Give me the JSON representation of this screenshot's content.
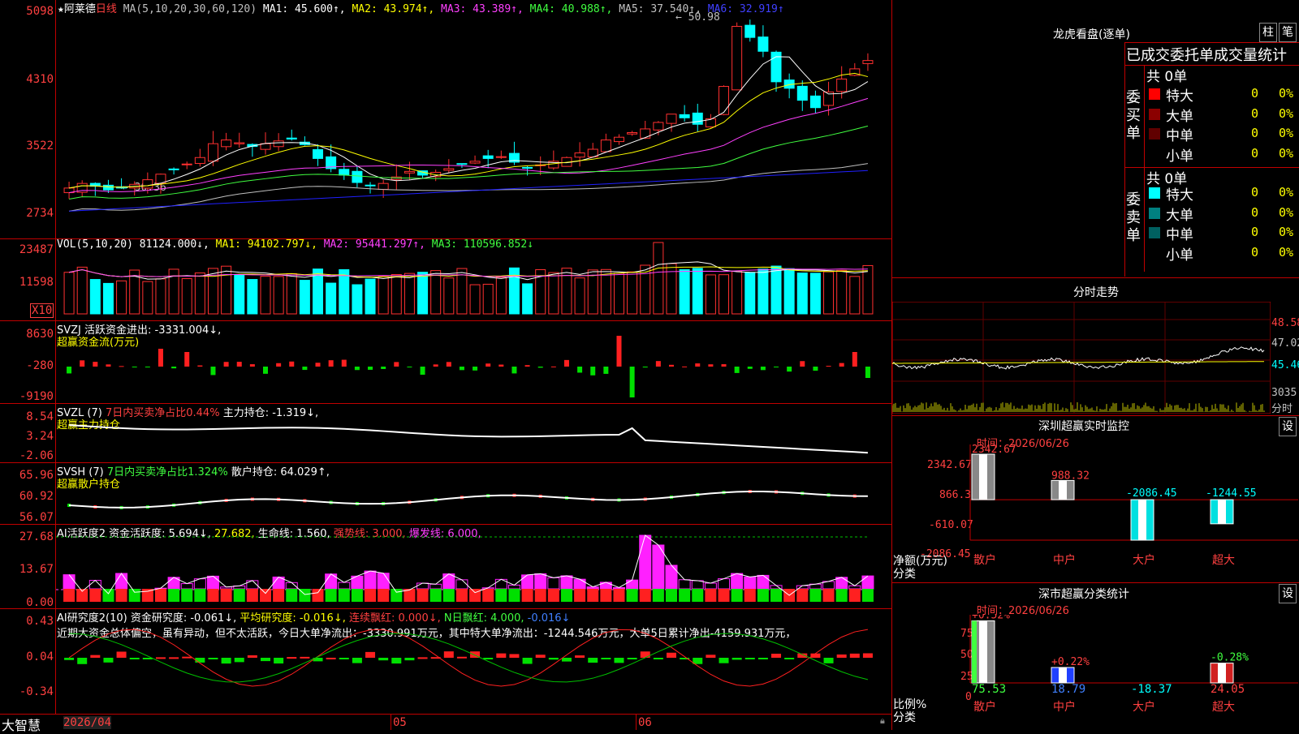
{
  "header": {
    "star": "★",
    "stock_name": "阿莱德",
    "period": "日线",
    "ma_label": "MA(5,10,20,30,60,120)",
    "ma1": "MA1: 45.600↑,",
    "ma2": "MA2: 43.974↑,",
    "ma3": "MA3: 43.389↑,",
    "ma4": "MA4: 40.988↑,",
    "ma5": "MA5: 37.540↑,",
    "ma6": "MA6: 32.919↑",
    "high_mark": "50.98",
    "low_mark": "30.36"
  },
  "price_axis": [
    "5098",
    "4310",
    "3522",
    "2734"
  ],
  "vol": {
    "label": "VOL(5,10,20) 81124.000↓,",
    "ma1": "MA1: 94102.797↓,",
    "ma2": "MA2: 95441.297↑,",
    "ma3": "MA3: 110596.852↓",
    "axis": [
      "23487",
      "11598"
    ],
    "unit": "X10"
  },
  "svzj": {
    "line1": "SVZJ 活跃资金进出: -3331.004↓,",
    "line2": "超赢资金流(万元)",
    "axis": [
      "8630",
      "-280",
      "-9190"
    ]
  },
  "svzl": {
    "label": "SVZL (7)",
    "desc": "7日内买卖净占比0.44%",
    "value": "主力持仓: -1.319↓,",
    "line2": "超赢主力持仓",
    "axis": [
      "8.54",
      "3.24",
      "-2.06"
    ]
  },
  "svsh": {
    "label": "SVSH (7)",
    "desc": "7日内买卖净占比1.324%",
    "value": "散户持仓: 64.029↑,",
    "line2": "超赢散户持仓",
    "axis": [
      "65.96",
      "60.92",
      "56.07"
    ]
  },
  "ai1": {
    "label": "AI活跃度2 资金活跃度: 5.694↓,",
    "v2": "27.682,",
    "v3": "生命线: 1.560,",
    "v4": "强势线: 3.000,",
    "v5": "爆发线: 6.000,",
    "axis": [
      "27.68",
      "13.67",
      "0.00"
    ]
  },
  "ai2": {
    "label": "AI研究度2(10) 资金研究度: -0.061↓,",
    "v2": "平均研究度: -0.016↓,",
    "v3": "连续飘红: 0.000↓,",
    "v4": "N日飘红: 4.000,",
    "v5": "-0.016↓",
    "summary": "近期大资金总体偏空，虽有异动，但不太活跃，今日大单净流出：-3330.991万元，其中特大单净流出：-1244.546万元，大单5日累计净出-4159.931万元，",
    "axis": [
      "0.43",
      "0.04",
      "-0.34"
    ]
  },
  "bottom": {
    "brand": "大智慧",
    "date": "2026/04",
    "m1": "05",
    "m2": "06"
  },
  "dragon": {
    "title": "龙虎看盘(逐单)",
    "btn1": "柱",
    "btn2": "笔",
    "tabs": "已成交委托单成交量统计",
    "buy_side": "委买单",
    "sell_side": "委卖单",
    "buy_total": "共 0单",
    "sell_total": "共 0单",
    "buy_rows": [
      {
        "name": "特大",
        "value": "0",
        "pct": "0%",
        "color": "#ff0000"
      },
      {
        "name": "大单",
        "value": "0",
        "pct": "0%",
        "color": "#8b0000"
      },
      {
        "name": "中单",
        "value": "0",
        "pct": "0%",
        "color": "#600000"
      },
      {
        "name": "小单",
        "value": "0",
        "pct": "0%",
        "color": "#000000"
      }
    ],
    "sell_rows": [
      {
        "name": "特大",
        "value": "0",
        "pct": "0%",
        "color": "#00ffff"
      },
      {
        "name": "大单",
        "value": "0",
        "pct": "0%",
        "color": "#008080"
      },
      {
        "name": "中单",
        "value": "0",
        "pct": "0%",
        "color": "#006060"
      },
      {
        "name": "小单",
        "value": "0",
        "pct": "0%",
        "color": "#000000"
      }
    ]
  },
  "fenshi": {
    "title": "分时走势",
    "axis": [
      "48.58",
      "47.02",
      "45.46"
    ],
    "vol": "3035",
    "vol_label": "分时"
  },
  "monitor": {
    "title": "深圳超赢实时监控",
    "btn": "设",
    "time": "时间：2026/06/26",
    "axis": [
      "2342.67",
      "866.3",
      "-610.07",
      "-2086.45"
    ],
    "ylabel": "净额(万元)",
    "xlabel": "分类",
    "cats": [
      "散户",
      "中户",
      "大户",
      "超大"
    ],
    "values": [
      "2342.67",
      "988.32",
      "-2086.45",
      "-1244.55"
    ]
  },
  "stats": {
    "title": "深市超赢分类统计",
    "btn": "设",
    "time": "时间：2026/06/26",
    "axis": [
      "75",
      "50",
      "25",
      "0"
    ],
    "ylabel": "比例%",
    "xlabel": "分类",
    "cats": [
      "散户",
      "中户",
      "大户",
      "超大"
    ],
    "tops": [
      "+0.52%",
      "+0.22%",
      "",
      "-0.28%"
    ],
    "values": [
      "75.53",
      "18.79",
      "-18.37",
      "24.05"
    ]
  }
}
